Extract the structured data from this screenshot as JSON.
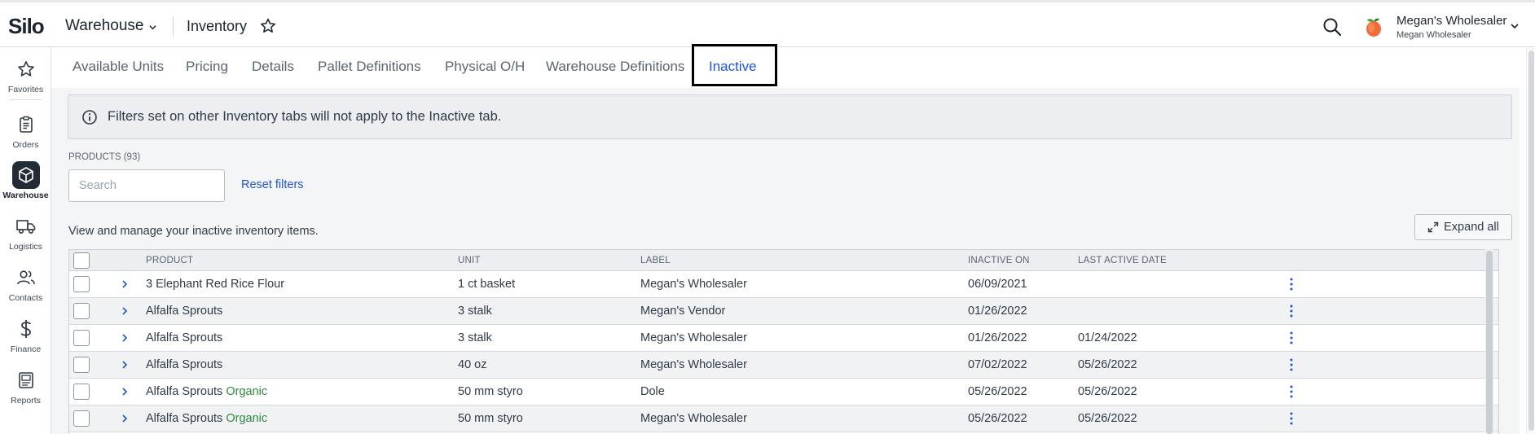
{
  "app": {
    "logo": "Silo",
    "module": "Warehouse",
    "page_title": "Inventory",
    "user_name": "Megan's Wholesaler",
    "user_sub": "Megan Wholesaler"
  },
  "sidebar": {
    "items": [
      {
        "label": "Favorites",
        "icon": "star-icon"
      },
      {
        "label": "Orders",
        "icon": "clipboard-icon"
      },
      {
        "label": "Warehouse",
        "icon": "box-icon",
        "active": true
      },
      {
        "label": "Logistics",
        "icon": "truck-icon"
      },
      {
        "label": "Contacts",
        "icon": "people-icon"
      },
      {
        "label": "Finance",
        "icon": "dollar-icon"
      },
      {
        "label": "Reports",
        "icon": "report-icon"
      }
    ]
  },
  "tabs": [
    {
      "label": "Available Units"
    },
    {
      "label": "Pricing"
    },
    {
      "label": "Details"
    },
    {
      "label": "Pallet Definitions"
    },
    {
      "label": "Physical O/H"
    },
    {
      "label": "Warehouse Definitions"
    },
    {
      "label": "Inactive",
      "active": true
    }
  ],
  "banner": {
    "text": "Filters set on other Inventory tabs will not apply to the Inactive tab."
  },
  "products": {
    "count_label": "PRODUCTS (93)",
    "search_placeholder": "Search",
    "reset_label": "Reset filters",
    "description": "View and manage your inactive inventory items.",
    "expand_label": "Expand all"
  },
  "table": {
    "columns": [
      "PRODUCT",
      "UNIT",
      "LABEL",
      "INACTIVE ON",
      "LAST ACTIVE DATE"
    ],
    "rows": [
      {
        "product": "3 Elephant Red Rice Flour",
        "tag": "",
        "unit": "1 ct basket",
        "label": "Megan's Wholesaler",
        "inactive_on": "06/09/2021",
        "last_active": ""
      },
      {
        "product": "Alfalfa Sprouts",
        "tag": "",
        "unit": "3 stalk",
        "label": "Megan's Vendor",
        "inactive_on": "01/26/2022",
        "last_active": ""
      },
      {
        "product": "Alfalfa Sprouts",
        "tag": "",
        "unit": "3 stalk",
        "label": "Megan's Wholesaler",
        "inactive_on": "01/26/2022",
        "last_active": "01/24/2022"
      },
      {
        "product": "Alfalfa Sprouts",
        "tag": "",
        "unit": "40 oz",
        "label": "Megan's Wholesaler",
        "inactive_on": "07/02/2022",
        "last_active": "05/26/2022"
      },
      {
        "product": "Alfalfa Sprouts",
        "tag": "Organic",
        "unit": "50 mm styro",
        "label": "Dole",
        "inactive_on": "05/26/2022",
        "last_active": "05/26/2022"
      },
      {
        "product": "Alfalfa Sprouts",
        "tag": "Organic",
        "unit": "50 mm styro",
        "label": "Megan's Wholesaler",
        "inactive_on": "05/26/2022",
        "last_active": "05/26/2022"
      }
    ]
  },
  "colors": {
    "accent": "#1e55d6",
    "organic": "#2e8b3e",
    "sidebar_active": "#232b36"
  }
}
